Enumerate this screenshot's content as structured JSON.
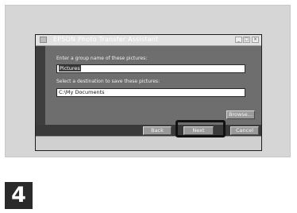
{
  "window": {
    "title": "EPSON Photo Transfer Assistant"
  },
  "dialog": {
    "group_label": "Enter a group name of these pictures:",
    "group_value": "Pictures",
    "dest_label": "Select a destination to save these pictures:",
    "dest_value": "C:\\My Documents",
    "browse_label": "Browse...",
    "back_label": "Back",
    "next_label": "Next",
    "cancel_label": "Cancel"
  },
  "step": {
    "number": "4"
  }
}
